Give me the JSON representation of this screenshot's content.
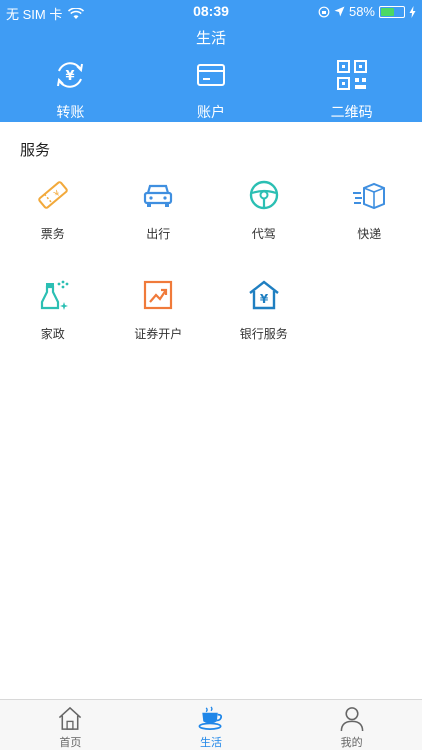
{
  "status": {
    "carrier": "无 SIM 卡",
    "time": "08:39",
    "battery": "58%",
    "battery_level": 0.58
  },
  "header": {
    "title": "生活"
  },
  "quick_actions": [
    {
      "label": "转账",
      "icon": "yuan-transfer-icon"
    },
    {
      "label": "账户",
      "icon": "card-icon"
    },
    {
      "label": "二维码",
      "icon": "qrcode-icon"
    }
  ],
  "services": {
    "title": "服务",
    "items": [
      {
        "label": "票务",
        "icon": "ticket-icon",
        "color": "#f2a93b"
      },
      {
        "label": "出行",
        "icon": "car-icon",
        "color": "#3f8fe0"
      },
      {
        "label": "代驾",
        "icon": "steering-wheel-icon",
        "color": "#2bbfb3"
      },
      {
        "label": "快递",
        "icon": "package-icon",
        "color": "#3f8fe0"
      },
      {
        "label": "家政",
        "icon": "cleaning-spray-icon",
        "color": "#2bbfb3"
      },
      {
        "label": "证券开户",
        "icon": "stock-chart-icon",
        "color": "#f07a3a"
      },
      {
        "label": "银行服务",
        "icon": "bank-house-icon",
        "color": "#1f7fc1"
      }
    ]
  },
  "tabs": [
    {
      "label": "首页",
      "icon": "home-icon"
    },
    {
      "label": "生活",
      "icon": "coffee-cup-icon",
      "active": true
    },
    {
      "label": "我的",
      "icon": "user-icon"
    }
  ],
  "colors": {
    "header_bg": "#3f9cf4",
    "tab_active": "#1f86e8"
  }
}
